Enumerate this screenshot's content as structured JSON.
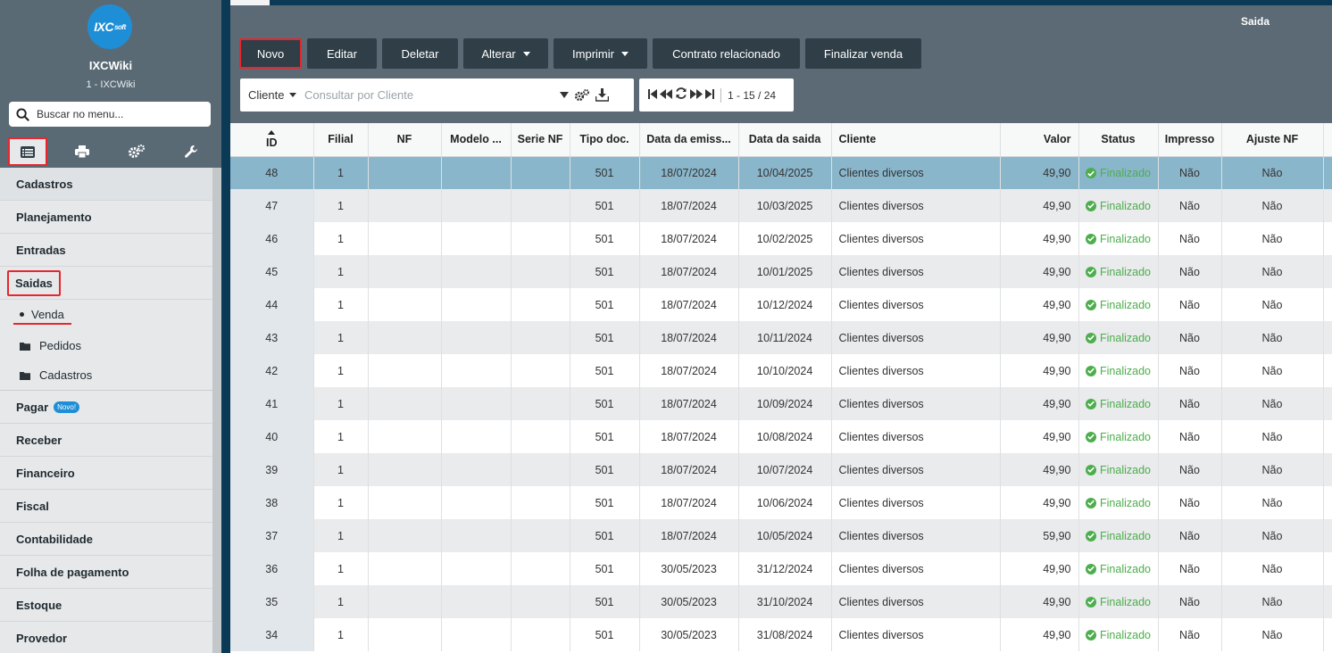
{
  "sidebar": {
    "logo_text": "IXC",
    "logo_suffix": "soft",
    "app_name": "IXCWiki",
    "app_sub": "1 - IXCWiki",
    "search_placeholder": "Buscar no menu...",
    "icons": [
      "list-icon",
      "printer-icon",
      "gears-icon",
      "wrench-icon"
    ],
    "menu_top": [
      "Cadastros",
      "Planejamento",
      "Entradas",
      "Saidas"
    ],
    "sub_items": [
      "Venda",
      "Pedidos",
      "Cadastros"
    ],
    "menu_bottom": [
      "Pagar",
      "Receber",
      "Financeiro",
      "Fiscal",
      "Contabilidade",
      "Folha de pagamento",
      "Estoque",
      "Provedor"
    ],
    "pagar_badge": "Novo!"
  },
  "panel": {
    "title": "Saida"
  },
  "toolbar": {
    "novo": "Novo",
    "editar": "Editar",
    "deletar": "Deletar",
    "alterar": "Alterar",
    "imprimir": "Imprimir",
    "contrato": "Contrato relacionado",
    "finalizar": "Finalizar venda"
  },
  "filter": {
    "field": "Cliente",
    "placeholder": "Consultar por Cliente"
  },
  "pager": {
    "info": "1 - 15 / 24"
  },
  "table": {
    "headers": [
      "ID",
      "Filial",
      "NF",
      "Modelo ...",
      "Serie NF",
      "Tipo doc.",
      "Data da emiss...",
      "Data da saida",
      "Cliente",
      "Valor",
      "Status",
      "Impresso",
      "Ajuste NF"
    ],
    "rows": [
      {
        "id": "48",
        "filial": "1",
        "nf": "",
        "modelo": "",
        "serie": "",
        "tipo": "501",
        "emissao": "18/07/2024",
        "saida": "10/04/2025",
        "cliente": "Clientes diversos",
        "valor": "49,90",
        "status": "Finalizado",
        "impresso": "Não",
        "ajuste": "Não"
      },
      {
        "id": "47",
        "filial": "1",
        "nf": "",
        "modelo": "",
        "serie": "",
        "tipo": "501",
        "emissao": "18/07/2024",
        "saida": "10/03/2025",
        "cliente": "Clientes diversos",
        "valor": "49,90",
        "status": "Finalizado",
        "impresso": "Não",
        "ajuste": "Não"
      },
      {
        "id": "46",
        "filial": "1",
        "nf": "",
        "modelo": "",
        "serie": "",
        "tipo": "501",
        "emissao": "18/07/2024",
        "saida": "10/02/2025",
        "cliente": "Clientes diversos",
        "valor": "49,90",
        "status": "Finalizado",
        "impresso": "Não",
        "ajuste": "Não"
      },
      {
        "id": "45",
        "filial": "1",
        "nf": "",
        "modelo": "",
        "serie": "",
        "tipo": "501",
        "emissao": "18/07/2024",
        "saida": "10/01/2025",
        "cliente": "Clientes diversos",
        "valor": "49,90",
        "status": "Finalizado",
        "impresso": "Não",
        "ajuste": "Não"
      },
      {
        "id": "44",
        "filial": "1",
        "nf": "",
        "modelo": "",
        "serie": "",
        "tipo": "501",
        "emissao": "18/07/2024",
        "saida": "10/12/2024",
        "cliente": "Clientes diversos",
        "valor": "49,90",
        "status": "Finalizado",
        "impresso": "Não",
        "ajuste": "Não"
      },
      {
        "id": "43",
        "filial": "1",
        "nf": "",
        "modelo": "",
        "serie": "",
        "tipo": "501",
        "emissao": "18/07/2024",
        "saida": "10/11/2024",
        "cliente": "Clientes diversos",
        "valor": "49,90",
        "status": "Finalizado",
        "impresso": "Não",
        "ajuste": "Não"
      },
      {
        "id": "42",
        "filial": "1",
        "nf": "",
        "modelo": "",
        "serie": "",
        "tipo": "501",
        "emissao": "18/07/2024",
        "saida": "10/10/2024",
        "cliente": "Clientes diversos",
        "valor": "49,90",
        "status": "Finalizado",
        "impresso": "Não",
        "ajuste": "Não"
      },
      {
        "id": "41",
        "filial": "1",
        "nf": "",
        "modelo": "",
        "serie": "",
        "tipo": "501",
        "emissao": "18/07/2024",
        "saida": "10/09/2024",
        "cliente": "Clientes diversos",
        "valor": "49,90",
        "status": "Finalizado",
        "impresso": "Não",
        "ajuste": "Não"
      },
      {
        "id": "40",
        "filial": "1",
        "nf": "",
        "modelo": "",
        "serie": "",
        "tipo": "501",
        "emissao": "18/07/2024",
        "saida": "10/08/2024",
        "cliente": "Clientes diversos",
        "valor": "49,90",
        "status": "Finalizado",
        "impresso": "Não",
        "ajuste": "Não"
      },
      {
        "id": "39",
        "filial": "1",
        "nf": "",
        "modelo": "",
        "serie": "",
        "tipo": "501",
        "emissao": "18/07/2024",
        "saida": "10/07/2024",
        "cliente": "Clientes diversos",
        "valor": "49,90",
        "status": "Finalizado",
        "impresso": "Não",
        "ajuste": "Não"
      },
      {
        "id": "38",
        "filial": "1",
        "nf": "",
        "modelo": "",
        "serie": "",
        "tipo": "501",
        "emissao": "18/07/2024",
        "saida": "10/06/2024",
        "cliente": "Clientes diversos",
        "valor": "49,90",
        "status": "Finalizado",
        "impresso": "Não",
        "ajuste": "Não"
      },
      {
        "id": "37",
        "filial": "1",
        "nf": "",
        "modelo": "",
        "serie": "",
        "tipo": "501",
        "emissao": "18/07/2024",
        "saida": "10/05/2024",
        "cliente": "Clientes diversos",
        "valor": "59,90",
        "status": "Finalizado",
        "impresso": "Não",
        "ajuste": "Não"
      },
      {
        "id": "36",
        "filial": "1",
        "nf": "",
        "modelo": "",
        "serie": "",
        "tipo": "501",
        "emissao": "30/05/2023",
        "saida": "31/12/2024",
        "cliente": "Clientes diversos",
        "valor": "49,90",
        "status": "Finalizado",
        "impresso": "Não",
        "ajuste": "Não"
      },
      {
        "id": "35",
        "filial": "1",
        "nf": "",
        "modelo": "",
        "serie": "",
        "tipo": "501",
        "emissao": "30/05/2023",
        "saida": "31/10/2024",
        "cliente": "Clientes diversos",
        "valor": "49,90",
        "status": "Finalizado",
        "impresso": "Não",
        "ajuste": "Não"
      },
      {
        "id": "34",
        "filial": "1",
        "nf": "",
        "modelo": "",
        "serie": "",
        "tipo": "501",
        "emissao": "30/05/2023",
        "saida": "31/08/2024",
        "cliente": "Clientes diversos",
        "valor": "49,90",
        "status": "Finalizado",
        "impresso": "Não",
        "ajuste": "Não"
      }
    ]
  },
  "colors": {
    "highlight": "#e8262e",
    "status_ok": "#4cae4c",
    "selected_row": "#8ab6cb",
    "toolbar_btn": "#2f3e47"
  }
}
